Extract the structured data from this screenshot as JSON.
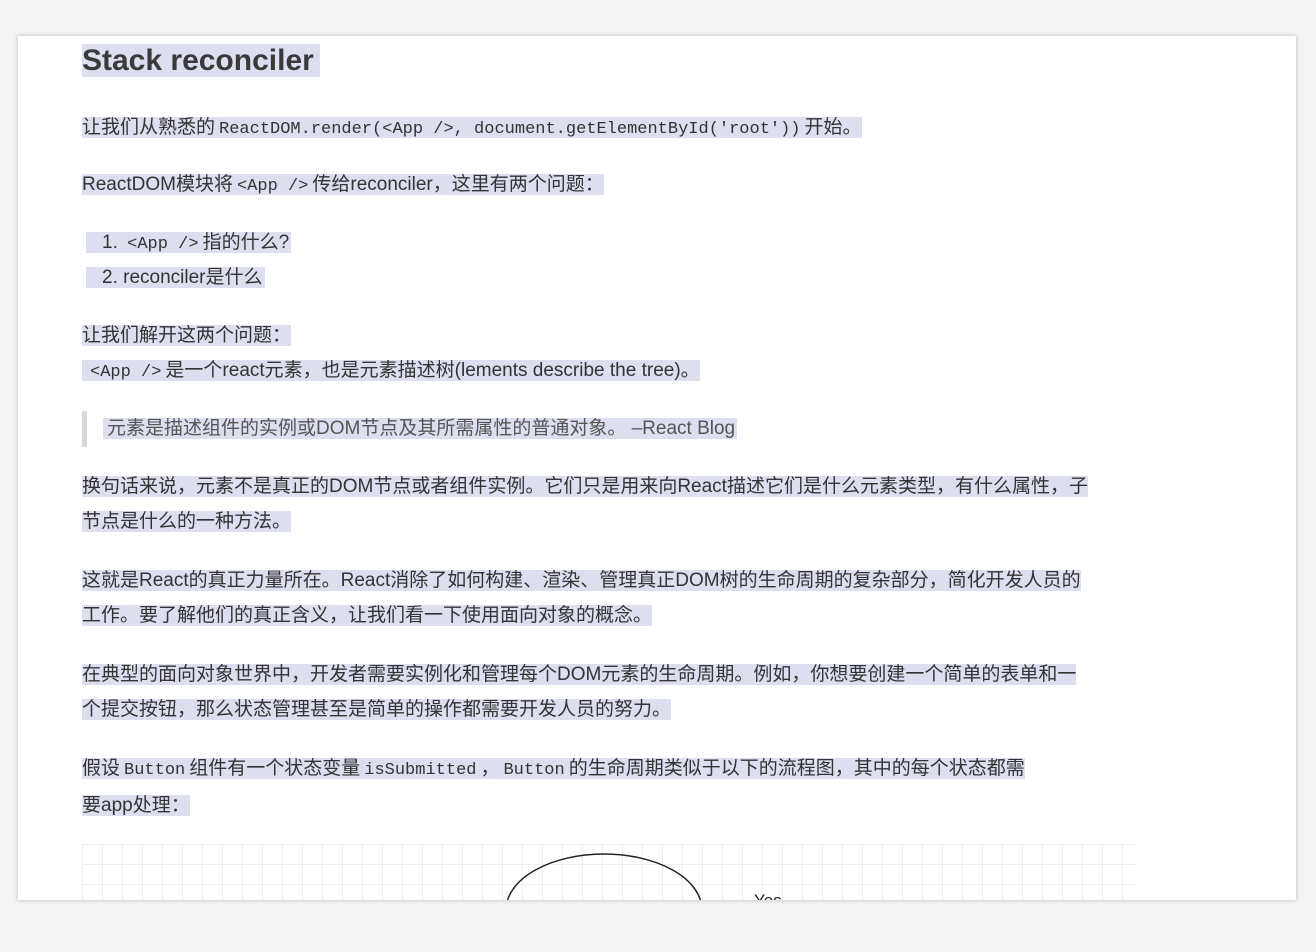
{
  "heading": "Stack reconciler",
  "para1": {
    "prefix": "让我们从熟悉的",
    "code": "ReactDOM.render(<App />, document.getElementById('root'))",
    "suffix": "开始。"
  },
  "para2": {
    "prefix": "ReactDOM模块将",
    "code": "<App />",
    "suffix": "传给reconciler，这里有两个问题："
  },
  "list": [
    {
      "num": "1.",
      "code": "<App />",
      "text": "指的什么?"
    },
    {
      "num": "2.",
      "text": "reconciler是什么"
    }
  ],
  "para3": {
    "line1": "让我们解开这两个问题：",
    "code": "<App />",
    "line2": "是一个react元素，也是元素描述树(lements describe the tree)。"
  },
  "quote": "元素是描述组件的实例或DOM节点及其所需属性的普通对象。 –React Blog",
  "para4": {
    "line1": "换句话来说，元素不是真正的DOM节点或者组件实例。它们只是用来向React描述它们是什么元素类型，有什么属性，子",
    "line2": "节点是什么的一种方法。"
  },
  "para5": {
    "line1": "这就是React的真正力量所在。React消除了如何构建、渲染、管理真正DOM树的生命周期的复杂部分，简化开发人员的",
    "line2": "工作。要了解他们的真正含义，让我们看一下使用面向对象的概念。"
  },
  "para6": {
    "line1": "在典型的面向对象世界中，开发者需要实例化和管理每个DOM元素的生命周期。例如，你想要创建一个简单的表单和一",
    "line2": "个提交按钮，那么状态管理甚至是简单的操作都需要开发人员的努力。"
  },
  "para7": {
    "t1": "假设",
    "code1": "Button",
    "t2": "组件有一个状态变量",
    "code2": "isSubmitted",
    "t3": "，",
    "code3": "Button",
    "t4": "的生命周期类似于以下的流程图，其中的每个状态都需",
    "line2": "要app处理："
  },
  "diagram": {
    "label": "Yes"
  }
}
